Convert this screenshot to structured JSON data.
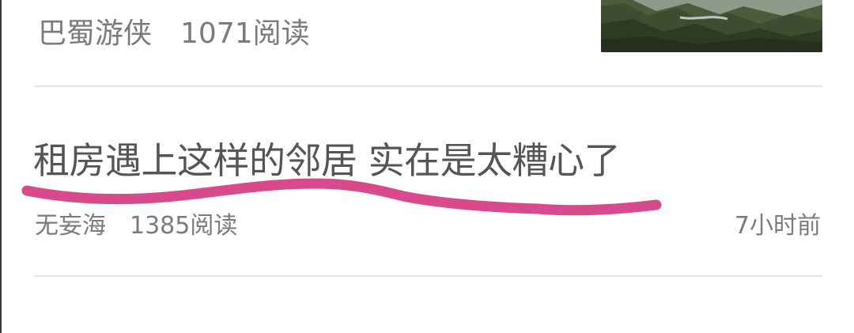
{
  "feed": {
    "item1": {
      "author": "巴蜀游侠",
      "reads": "1071阅读",
      "thumbnail": "mountain-landscape-photo"
    },
    "item2": {
      "title": "租房遇上这样的邻居 实在是太糟心了",
      "author": "无妄海",
      "reads": "1385阅读",
      "time": "7小时前"
    }
  },
  "colors": {
    "text_meta": "#7b7b7b",
    "text_title": "#555555",
    "divider": "#e4e4e4",
    "highlight_stroke": "#d94a8c"
  }
}
